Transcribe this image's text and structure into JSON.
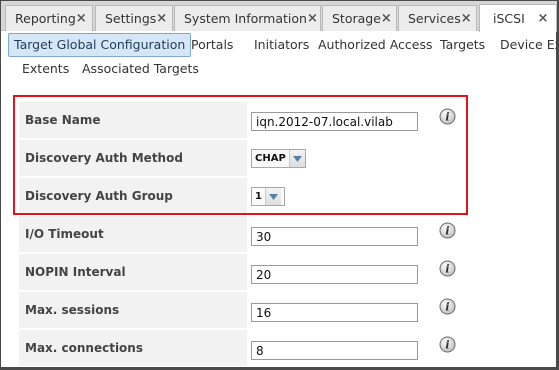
{
  "tabs": [
    {
      "label": "Reporting",
      "closable": true,
      "active": false
    },
    {
      "label": "Settings",
      "closable": true,
      "active": false
    },
    {
      "label": "System Information",
      "closable": true,
      "active": false
    },
    {
      "label": "Storage",
      "closable": true,
      "active": false
    },
    {
      "label": "Services",
      "closable": true,
      "active": false
    },
    {
      "label": "iSCSI",
      "closable": true,
      "active": true
    }
  ],
  "close_glyph": "×",
  "subnav": {
    "row1": [
      "Target Global Configuration",
      "Portals",
      "Initiators",
      "Authorized Access",
      "Targets",
      "Device Ext"
    ],
    "row2": [
      "Extents",
      "Associated Targets"
    ],
    "active": "Target Global Configuration"
  },
  "form": {
    "base_name": {
      "label": "Base Name",
      "value": "iqn.2012-07.local.vilab"
    },
    "discovery_auth_method": {
      "label": "Discovery Auth Method",
      "value": "CHAP"
    },
    "discovery_auth_group": {
      "label": "Discovery Auth Group",
      "value": "1"
    },
    "io_timeout": {
      "label": "I/O Timeout",
      "value": "30"
    },
    "nopin_interval": {
      "label": "NOPIN Interval",
      "value": "20"
    },
    "max_sessions": {
      "label": "Max. sessions",
      "value": "16"
    },
    "max_connections": {
      "label": "Max. connections",
      "value": "8"
    }
  },
  "icons": {
    "info": "info-icon",
    "close": "close-icon",
    "dropdown": "chevron-down-icon"
  },
  "colors": {
    "highlight": "#e2131b",
    "active_subnav": "#d5e6f6",
    "label_bg": "#f2f2f2"
  }
}
